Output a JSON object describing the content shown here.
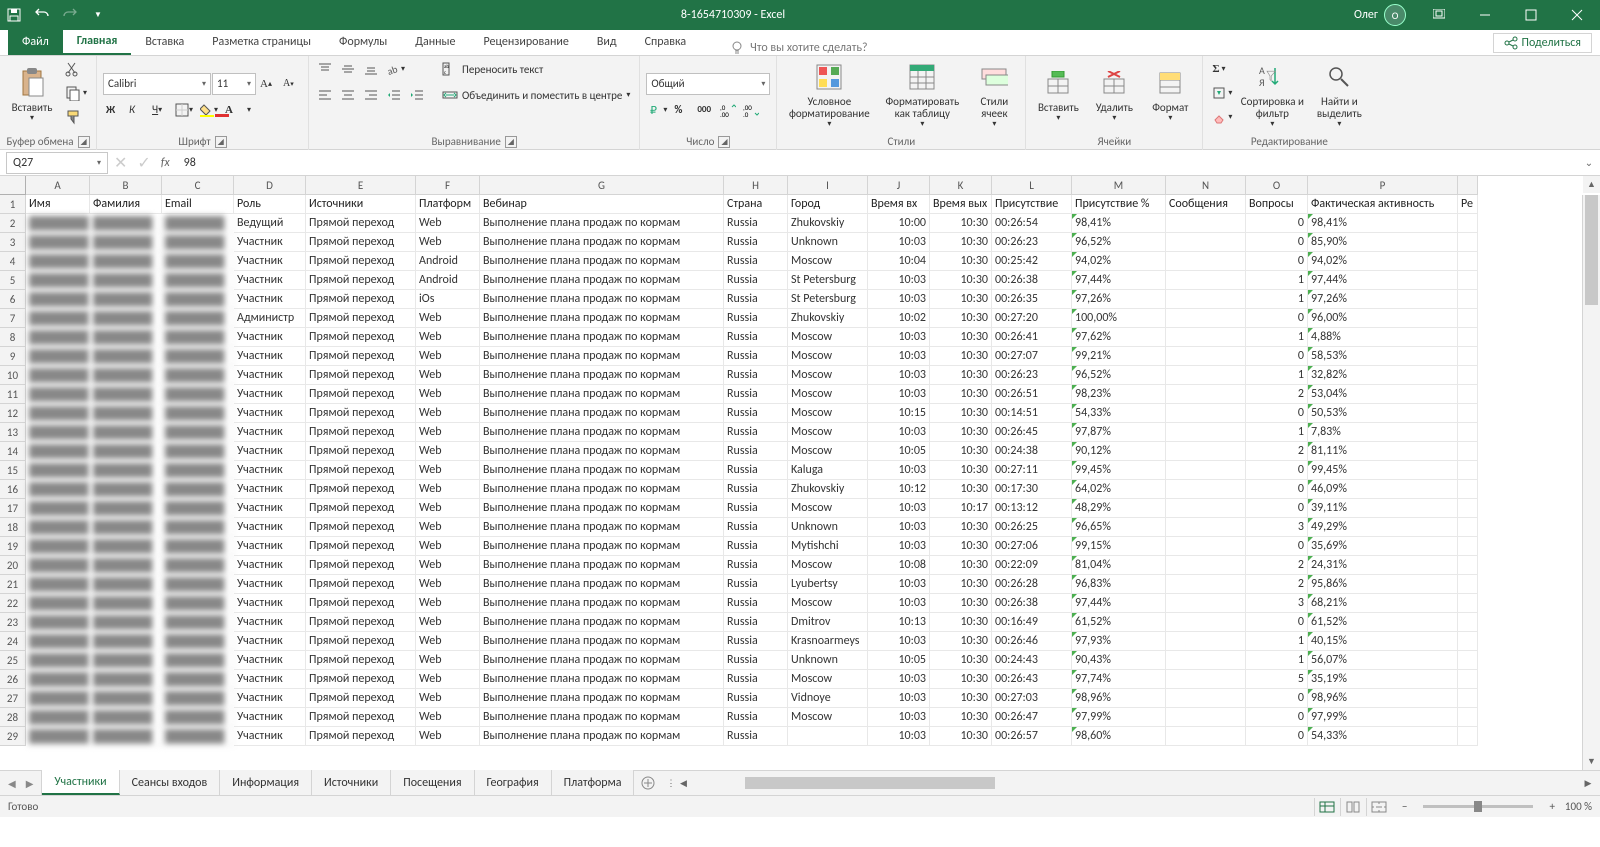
{
  "title": "8-1654710309 - Excel",
  "user": "Олег",
  "ribbon_tabs": {
    "file": "Файл",
    "home": "Главная",
    "insert": "Вставка",
    "page": "Разметка страницы",
    "formulas": "Формулы",
    "data": "Данные",
    "review": "Рецензирование",
    "view": "Вид",
    "help": "Справка",
    "tellme": "Что вы хотите сделать?",
    "share": "Поделиться"
  },
  "ribbon": {
    "clipboard": {
      "paste": "Вставить",
      "label": "Буфер обмена"
    },
    "font": {
      "name": "Calibri",
      "size": "11",
      "label": "Шрифт"
    },
    "alignment": {
      "wrap": "Переносить текст",
      "merge": "Объединить и поместить в центре",
      "label": "Выравнивание"
    },
    "number": {
      "format": "Общий",
      "label": "Число"
    },
    "styles": {
      "cond": "Условное форматирование",
      "table": "Форматировать как таблицу",
      "cell": "Стили ячеек",
      "label": "Стили"
    },
    "cells": {
      "insert": "Вставить",
      "delete": "Удалить",
      "format": "Формат",
      "label": "Ячейки"
    },
    "editing": {
      "sort": "Сортировка и фильтр",
      "find": "Найти и выделить",
      "label": "Редактирование"
    }
  },
  "namebox": "Q27",
  "formula": "98",
  "columns": [
    "A",
    "B",
    "C",
    "D",
    "E",
    "F",
    "G",
    "H",
    "I",
    "J",
    "K",
    "L",
    "M",
    "N",
    "O",
    "P",
    ""
  ],
  "headers": [
    "Имя",
    "Фамилия",
    "Email",
    "Роль",
    "Источники",
    "Платформ",
    "Вебинар",
    "Страна",
    "Город",
    "Время вх",
    "Время вых",
    "Присутствие",
    "Присутствие %",
    "Сообщения",
    "Вопросы",
    "Фактическая активность",
    "Ре"
  ],
  "rows": [
    {
      "n": 2,
      "d": [
        "",
        "",
        "",
        "Ведущий",
        "Прямой переход",
        "Web",
        "Выполнение плана продаж по кормам",
        "Russia",
        "Zhukovskiy",
        "10:00",
        "10:30",
        "00:26:54",
        "98,41%",
        "",
        "0",
        "98,41%",
        ""
      ]
    },
    {
      "n": 3,
      "d": [
        "",
        "",
        "",
        "Участник",
        "Прямой переход",
        "Web",
        "Выполнение плана продаж по кормам",
        "Russia",
        "Unknown",
        "10:03",
        "10:30",
        "00:26:23",
        "96,52%",
        "",
        "0",
        "85,90%",
        ""
      ]
    },
    {
      "n": 4,
      "d": [
        "",
        "",
        "",
        "Участник",
        "Прямой переход",
        "Android",
        "Выполнение плана продаж по кормам",
        "Russia",
        "Moscow",
        "10:04",
        "10:30",
        "00:25:42",
        "94,02%",
        "",
        "0",
        "94,02%",
        ""
      ]
    },
    {
      "n": 5,
      "d": [
        "",
        "",
        "",
        "Участник",
        "Прямой переход",
        "Android",
        "Выполнение плана продаж по кормам",
        "Russia",
        "St Petersburg",
        "10:03",
        "10:30",
        "00:26:38",
        "97,44%",
        "",
        "1",
        "97,44%",
        ""
      ]
    },
    {
      "n": 6,
      "d": [
        "",
        "",
        "",
        "Участник",
        "Прямой переход",
        "iOs",
        "Выполнение плана продаж по кормам",
        "Russia",
        "St Petersburg",
        "10:03",
        "10:30",
        "00:26:35",
        "97,26%",
        "",
        "1",
        "97,26%",
        ""
      ]
    },
    {
      "n": 7,
      "d": [
        "",
        "",
        "",
        "Администр",
        "Прямой переход",
        "Web",
        "Выполнение плана продаж по кормам",
        "Russia",
        "Zhukovskiy",
        "10:02",
        "10:30",
        "00:27:20",
        "100,00%",
        "",
        "0",
        "96,00%",
        ""
      ]
    },
    {
      "n": 8,
      "d": [
        "",
        "",
        "",
        "Участник",
        "Прямой переход",
        "Web",
        "Выполнение плана продаж по кормам",
        "Russia",
        "Moscow",
        "10:03",
        "10:30",
        "00:26:41",
        "97,62%",
        "",
        "1",
        "4,88%",
        ""
      ]
    },
    {
      "n": 9,
      "d": [
        "",
        "",
        "",
        "Участник",
        "Прямой переход",
        "Web",
        "Выполнение плана продаж по кормам",
        "Russia",
        "Moscow",
        "10:03",
        "10:30",
        "00:27:07",
        "99,21%",
        "",
        "0",
        "58,53%",
        ""
      ]
    },
    {
      "n": 10,
      "d": [
        "",
        "",
        "",
        "Участник",
        "Прямой переход",
        "Web",
        "Выполнение плана продаж по кормам",
        "Russia",
        "Moscow",
        "10:03",
        "10:30",
        "00:26:23",
        "96,52%",
        "",
        "1",
        "32,82%",
        ""
      ]
    },
    {
      "n": 11,
      "d": [
        "",
        "",
        "",
        "Участник",
        "Прямой переход",
        "Web",
        "Выполнение плана продаж по кормам",
        "Russia",
        "Moscow",
        "10:03",
        "10:30",
        "00:26:51",
        "98,23%",
        "",
        "2",
        "53,04%",
        ""
      ]
    },
    {
      "n": 12,
      "d": [
        "",
        "",
        "",
        "Участник",
        "Прямой переход",
        "Web",
        "Выполнение плана продаж по кормам",
        "Russia",
        "Moscow",
        "10:15",
        "10:30",
        "00:14:51",
        "54,33%",
        "",
        "0",
        "50,53%",
        ""
      ]
    },
    {
      "n": 13,
      "d": [
        "",
        "",
        "",
        "Участник",
        "Прямой переход",
        "Web",
        "Выполнение плана продаж по кормам",
        "Russia",
        "Moscow",
        "10:03",
        "10:30",
        "00:26:45",
        "97,87%",
        "",
        "1",
        "7,83%",
        ""
      ]
    },
    {
      "n": 14,
      "d": [
        "",
        "",
        "",
        "Участник",
        "Прямой переход",
        "Web",
        "Выполнение плана продаж по кормам",
        "Russia",
        "Moscow",
        "10:05",
        "10:30",
        "00:24:38",
        "90,12%",
        "",
        "2",
        "81,11%",
        ""
      ]
    },
    {
      "n": 15,
      "d": [
        "",
        "",
        "",
        "Участник",
        "Прямой переход",
        "Web",
        "Выполнение плана продаж по кормам",
        "Russia",
        "Kaluga",
        "10:03",
        "10:30",
        "00:27:11",
        "99,45%",
        "",
        "0",
        "99,45%",
        ""
      ]
    },
    {
      "n": 16,
      "d": [
        "",
        "",
        "",
        "Участник",
        "Прямой переход",
        "Web",
        "Выполнение плана продаж по кормам",
        "Russia",
        "Zhukovskiy",
        "10:12",
        "10:30",
        "00:17:30",
        "64,02%",
        "",
        "0",
        "46,09%",
        ""
      ]
    },
    {
      "n": 17,
      "d": [
        "",
        "",
        "",
        "Участник",
        "Прямой переход",
        "Web",
        "Выполнение плана продаж по кормам",
        "Russia",
        "Moscow",
        "10:03",
        "10:17",
        "00:13:12",
        "48,29%",
        "",
        "0",
        "39,11%",
        ""
      ]
    },
    {
      "n": 18,
      "d": [
        "",
        "",
        "",
        "Участник",
        "Прямой переход",
        "Web",
        "Выполнение плана продаж по кормам",
        "Russia",
        "Unknown",
        "10:03",
        "10:30",
        "00:26:25",
        "96,65%",
        "",
        "3",
        "49,29%",
        ""
      ]
    },
    {
      "n": 19,
      "d": [
        "",
        "",
        "",
        "Участник",
        "Прямой переход",
        "Web",
        "Выполнение плана продаж по кормам",
        "Russia",
        "Mytishchi",
        "10:03",
        "10:30",
        "00:27:06",
        "99,15%",
        "",
        "0",
        "35,69%",
        ""
      ]
    },
    {
      "n": 20,
      "d": [
        "",
        "",
        "",
        "Участник",
        "Прямой переход",
        "Web",
        "Выполнение плана продаж по кормам",
        "Russia",
        "Moscow",
        "10:08",
        "10:30",
        "00:22:09",
        "81,04%",
        "",
        "2",
        "24,31%",
        ""
      ]
    },
    {
      "n": 21,
      "d": [
        "",
        "",
        "",
        "Участник",
        "Прямой переход",
        "Web",
        "Выполнение плана продаж по кормам",
        "Russia",
        "Lyubertsy",
        "10:03",
        "10:30",
        "00:26:28",
        "96,83%",
        "",
        "2",
        "95,86%",
        ""
      ]
    },
    {
      "n": 22,
      "d": [
        "",
        "",
        "",
        "Участник",
        "Прямой переход",
        "Web",
        "Выполнение плана продаж по кормам",
        "Russia",
        "Moscow",
        "10:03",
        "10:30",
        "00:26:38",
        "97,44%",
        "",
        "3",
        "68,21%",
        ""
      ]
    },
    {
      "n": 23,
      "d": [
        "",
        "",
        "",
        "Участник",
        "Прямой переход",
        "Web",
        "Выполнение плана продаж по кормам",
        "Russia",
        "Dmitrov",
        "10:13",
        "10:30",
        "00:16:49",
        "61,52%",
        "",
        "0",
        "61,52%",
        ""
      ]
    },
    {
      "n": 24,
      "d": [
        "",
        "",
        "",
        "Участник",
        "Прямой переход",
        "Web",
        "Выполнение плана продаж по кормам",
        "Russia",
        "Krasnoarmeys",
        "10:03",
        "10:30",
        "00:26:46",
        "97,93%",
        "",
        "1",
        "40,15%",
        ""
      ]
    },
    {
      "n": 25,
      "d": [
        "",
        "",
        "",
        "Участник",
        "Прямой переход",
        "Web",
        "Выполнение плана продаж по кормам",
        "Russia",
        "Unknown",
        "10:05",
        "10:30",
        "00:24:43",
        "90,43%",
        "",
        "1",
        "56,07%",
        ""
      ]
    },
    {
      "n": 26,
      "d": [
        "",
        "",
        "",
        "Участник",
        "Прямой переход",
        "Web",
        "Выполнение плана продаж по кормам",
        "Russia",
        "Moscow",
        "10:03",
        "10:30",
        "00:26:43",
        "97,74%",
        "",
        "5",
        "35,19%",
        ""
      ]
    },
    {
      "n": 27,
      "d": [
        "",
        "",
        "",
        "Участник",
        "Прямой переход",
        "Web",
        "Выполнение плана продаж по кормам",
        "Russia",
        "Vidnoye",
        "10:03",
        "10:30",
        "00:27:03",
        "98,96%",
        "",
        "0",
        "98,96%",
        ""
      ]
    },
    {
      "n": 28,
      "d": [
        "",
        "",
        "",
        "Участник",
        "Прямой переход",
        "Web",
        "Выполнение плана продаж по кормам",
        "Russia",
        "Moscow",
        "10:03",
        "10:30",
        "00:26:47",
        "97,99%",
        "",
        "0",
        "97,99%",
        ""
      ]
    },
    {
      "n": 29,
      "d": [
        "",
        "",
        "",
        "Участник",
        "Прямой переход",
        "Web",
        "Выполнение плана продаж по кормам",
        "Russia",
        "",
        "10:03",
        "10:30",
        "00:26:57",
        "98,60%",
        "",
        "0",
        "54,33%",
        ""
      ]
    }
  ],
  "right_align_cols": [
    9,
    10,
    13,
    14
  ],
  "percent_cols": [
    12,
    15
  ],
  "sheets": [
    "Участники",
    "Сеансы входов",
    "Информация",
    "Источники",
    "Посещения",
    "География",
    "Платформа"
  ],
  "status": {
    "ready": "Готово",
    "zoom": "100 %"
  }
}
